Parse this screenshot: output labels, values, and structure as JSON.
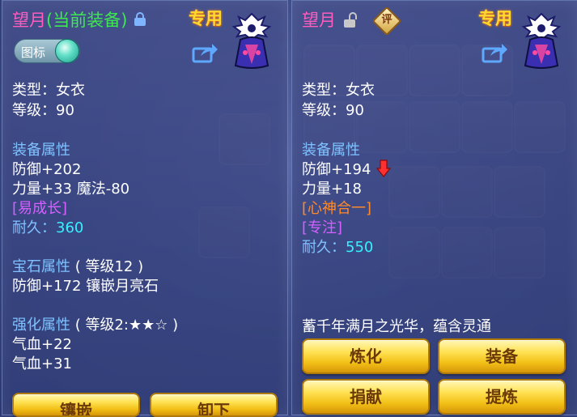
{
  "left": {
    "item_name": "望月",
    "equipped_tag": "(当前装备)",
    "exclusive": "专用",
    "toggle_label": "图标",
    "type": "类型：女衣",
    "level": "等级：90",
    "equip_attr_header": "装备属性",
    "defense": "防御+202",
    "strength_magic": "力量+33 魔法-80",
    "special": "[易成长]",
    "durability_label": "耐久：",
    "durability_value": "360",
    "gem_header": "宝石属性",
    "gem_level": "( 等级12 )",
    "gem_detail": "防御+172 镶嵌月亮石",
    "enhance_header": "强化属性",
    "enhance_level": "( 等级2:★★☆ )",
    "hp1": "气血+22",
    "hp2": "气血+31",
    "buttons": [
      "镶嵌",
      "卸下"
    ]
  },
  "right": {
    "item_name": "望月",
    "rate_badge": "评",
    "exclusive": "专用",
    "type": "类型：女衣",
    "level": "等级：90",
    "equip_attr_header": "装备属性",
    "defense": "防御+194",
    "strength": "力量+18",
    "special1": "[心神合一]",
    "special2": "[专注]",
    "durability_label": "耐久：",
    "durability_value": "550",
    "description": "蓄千年满月之光华，蕴含灵通",
    "buttons": [
      "炼化",
      "装备",
      "捐献",
      "提炼"
    ]
  },
  "colors": {
    "name": "#ff5cbe",
    "equipped": "#3ee850",
    "exclusive": "#ffd92e",
    "section": "#7fc2ff",
    "durability_value": "#35f1ff",
    "special_orange": "#ff8a2a",
    "special_purple": "#d560ff",
    "button_gold": "#f2c016"
  },
  "icons": [
    "lock-icon",
    "unlock-icon",
    "share-icon",
    "portrait-icon",
    "down-arrow-icon",
    "rate-badge-icon"
  ]
}
